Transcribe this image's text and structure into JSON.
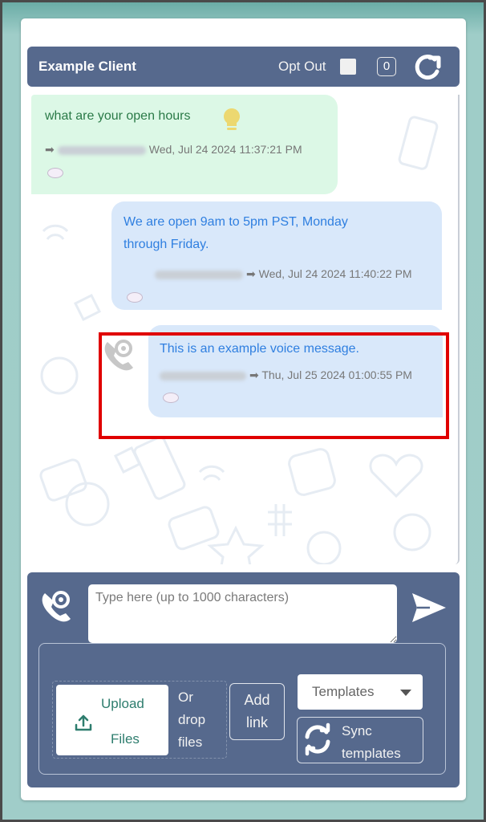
{
  "header": {
    "title": "Example Client",
    "opt_out_label": "Opt Out",
    "opt_out_checked": false,
    "unread_count": "0",
    "refresh_icon": "refresh-icon"
  },
  "messages": [
    {
      "direction": "incoming",
      "text": "what are your open hours",
      "icon": "lightbulb-icon",
      "sender": "Steven Martinez",
      "sender_blurred": true,
      "timestamp": "Wed, Jul 24 2024 11:37:21 PM",
      "reaction": "reaction-icon"
    },
    {
      "direction": "outgoing",
      "text_line1": "We are open 9am to 5pm PST, Monday",
      "text_line2": "through Friday.",
      "sender": "David Schonert",
      "sender_blurred": true,
      "timestamp": "Wed, Jul 24 2024 11:40:22 PM",
      "reaction": "reaction-icon"
    },
    {
      "direction": "outgoing",
      "type": "voice",
      "text": "This is an example voice message.",
      "sender": "David Schonert",
      "sender_blurred": true,
      "timestamp": "Thu, Jul 25 2024 01:00:55 PM",
      "reaction": "reaction-icon",
      "highlighted": true
    }
  ],
  "composer": {
    "placeholder": "Type here (up to 1000 characters)",
    "value": "",
    "upload_line1": "Upload",
    "upload_line2": "Files",
    "drop_text_1": "Or",
    "drop_text_2": "drop",
    "drop_text_3": "files",
    "add_link_1": "Add",
    "add_link_2": "link",
    "templates_selected": "Templates",
    "sync_line1": "Sync",
    "sync_line2": "templates"
  },
  "colors": {
    "header_bg": "#56698d",
    "incoming_bubble": "#dcf8e6",
    "outgoing_bubble": "#d9e8fa",
    "incoming_text": "#2a7a47",
    "outgoing_text": "#2f7fe0",
    "highlight": "#e00000",
    "page_bg": "#a0cdc9"
  }
}
